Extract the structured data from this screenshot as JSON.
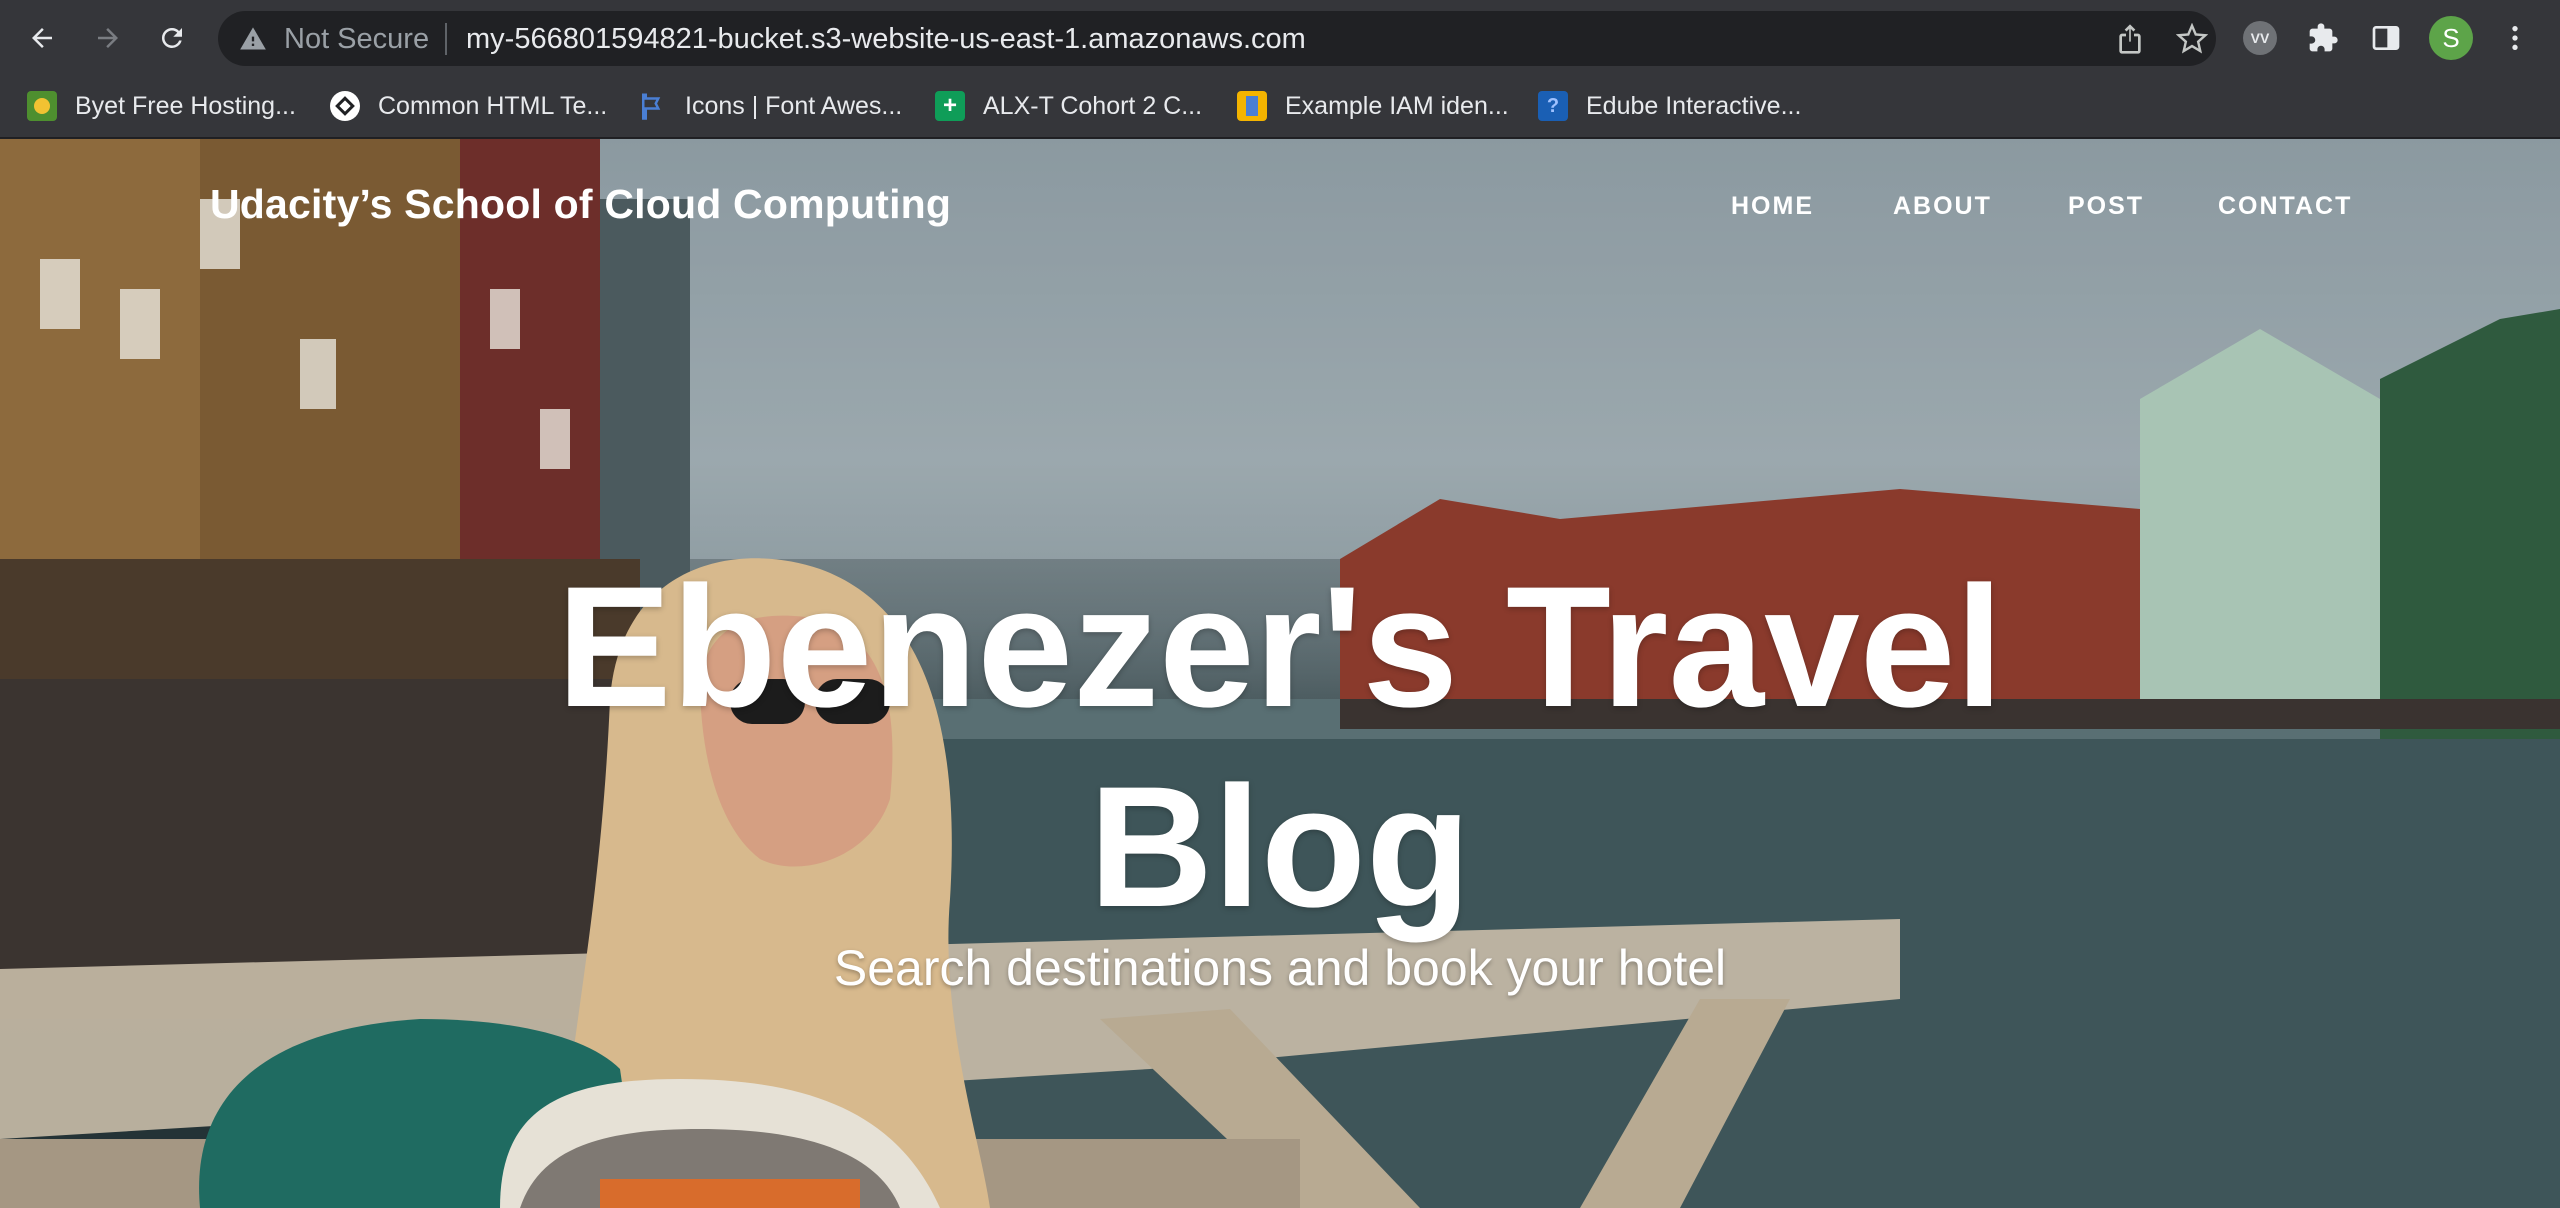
{
  "browser": {
    "security_label": "Not Secure",
    "url": "my-566801594821-bucket.s3-website-us-east-1.amazonaws.com",
    "avatar_letter": "S",
    "extension_badge": "VV",
    "bookmarks": [
      {
        "label": "Byet Free Hosting...",
        "icon": "byet-favicon",
        "color": "#4e8f2f"
      },
      {
        "label": "Common HTML Te...",
        "icon": "html-favicon",
        "color": "#ffffff"
      },
      {
        "label": "Icons | Font Awes...",
        "icon": "flag-favicon",
        "color": "#4a7fd4"
      },
      {
        "label": "ALX-T Cohort 2 C...",
        "icon": "sheets-favicon",
        "color": "#0f9d58"
      },
      {
        "label": "Example IAM iden...",
        "icon": "package-favicon",
        "color": "#f4b400"
      },
      {
        "label": "Edube Interactive...",
        "icon": "edube-favicon",
        "color": "#1a5fb4"
      }
    ]
  },
  "site": {
    "brand": "Udacity’s School of Cloud Computing",
    "nav": [
      {
        "label": "HOME"
      },
      {
        "label": "ABOUT"
      },
      {
        "label": "POST"
      },
      {
        "label": "CONTACT"
      }
    ],
    "hero": {
      "title": "Ebenezer's Travel Blog",
      "subtitle": "Search destinations and book your hotel"
    }
  }
}
